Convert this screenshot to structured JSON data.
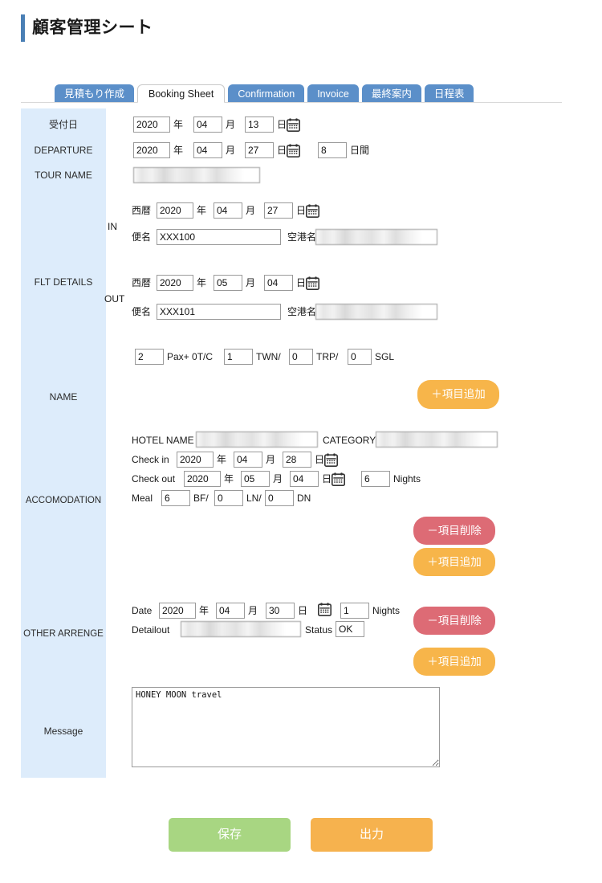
{
  "header": {
    "title": "顧客管理シート",
    "accent_color": "#4a7fb5"
  },
  "tabs": [
    {
      "label": "見積もり作成",
      "active": false
    },
    {
      "label": "Booking Sheet",
      "active": true
    },
    {
      "label": "Confirmation",
      "active": false
    },
    {
      "label": "Invoice",
      "active": false
    },
    {
      "label": "最終案内",
      "active": false
    },
    {
      "label": "日程表",
      "active": false
    }
  ],
  "sidebar": {
    "background_color": "#ddecfb",
    "items": [
      {
        "label": "受付日"
      },
      {
        "label": "DEPARTURE"
      },
      {
        "label": "TOUR NAME"
      },
      {
        "label": "FLT DETAILS"
      },
      {
        "label": "NAME"
      },
      {
        "label": "ACCOMODATION"
      },
      {
        "label": "OTHER ARRENGE"
      },
      {
        "label": "Message"
      }
    ]
  },
  "reception": {
    "year": "2020",
    "year_unit": "年",
    "month": "04",
    "month_unit": "月",
    "day": "13",
    "day_unit": "日",
    "calendar_icon": "calendar-icon"
  },
  "departure": {
    "year": "2020",
    "year_unit": "年",
    "month": "04",
    "month_unit": "月",
    "day": "27",
    "day_unit": "日",
    "duration": "8",
    "duration_unit": "日間",
    "calendar_icon": "calendar-icon"
  },
  "tour_name": {
    "value": "",
    "redacted": true
  },
  "flt_details": {
    "in": {
      "group_label": "IN",
      "era_label": "西暦",
      "year": "2020",
      "year_unit": "年",
      "month": "04",
      "month_unit": "月",
      "day": "27",
      "day_unit": "日",
      "flight_label": "便名",
      "flight_no": "XXX100",
      "airport_label": "空港名",
      "airport": "",
      "airport_redacted": true
    },
    "out": {
      "group_label": "OUT",
      "era_label": "西暦",
      "year": "2020",
      "year_unit": "年",
      "month": "05",
      "month_unit": "月",
      "day": "04",
      "day_unit": "日",
      "flight_label": "便名",
      "flight_no": "XXX101",
      "airport_label": "空港名",
      "airport": "",
      "airport_redacted": true
    }
  },
  "name_section": {
    "pax": "2",
    "pax_label": "Pax+ 0T/C",
    "twn": "1",
    "twn_label": "TWN/",
    "trp": "0",
    "trp_label": "TRP/",
    "sgl": "0",
    "sgl_label": "SGL",
    "add_button": "＋項目追加"
  },
  "accomodation": {
    "hotel_name_label": "HOTEL NAME",
    "hotel_name": "",
    "hotel_name_redacted": true,
    "category_label": "CATEGORY",
    "category": "",
    "category_redacted": true,
    "checkin_label": "Check in",
    "checkin": {
      "year": "2020",
      "year_unit": "年",
      "month": "04",
      "month_unit": "月",
      "day": "28",
      "day_unit": "日"
    },
    "checkout_label": "Check out",
    "checkout": {
      "year": "2020",
      "year_unit": "年",
      "month": "05",
      "month_unit": "月",
      "day": "04",
      "day_unit": "日"
    },
    "nights": "6",
    "nights_label": "Nights",
    "meal_label": "Meal",
    "bf": "6",
    "bf_label": "BF/",
    "ln": "0",
    "ln_label": "LN/",
    "dn": "0",
    "dn_label": "DN",
    "delete_button": "－項目削除",
    "add_button": "＋項目追加"
  },
  "other_arrenge": {
    "date_label": "Date",
    "year": "2020",
    "year_unit": "年",
    "month": "04",
    "month_unit": "月",
    "day": "30",
    "day_unit": "日",
    "nights": "1",
    "nights_label": "Nights",
    "detail_label": "Detailout",
    "detail": "",
    "detail_redacted": true,
    "status_label": "Status",
    "status": "OK",
    "delete_button": "－項目削除",
    "add_button": "＋項目追加"
  },
  "message": {
    "value": "HONEY MOON travel"
  },
  "footer": {
    "save_label": "保存",
    "save_color": "#a8d682",
    "export_label": "出力",
    "export_color": "#f6b24e"
  }
}
